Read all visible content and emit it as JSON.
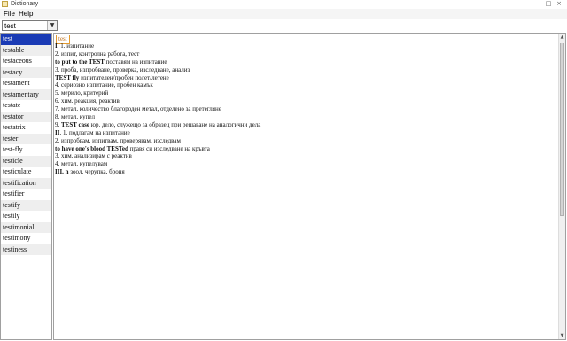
{
  "window": {
    "title": "Dictionary",
    "icon": "dictionary-app-icon"
  },
  "menu": {
    "file": "File",
    "help": "Help"
  },
  "search": {
    "value": "test",
    "dropdown_icon": "chevron-down-icon"
  },
  "word_list": {
    "selected": "test",
    "items": [
      "test",
      "testable",
      "testaceous",
      "testacy",
      "testament",
      "testamentary",
      "testate",
      "testator",
      "testatrix",
      "tester",
      "test-fly",
      "testicle",
      "testiculate",
      "testification",
      "testifier",
      "testify",
      "testily",
      "testimonial",
      "testimony",
      "testiness"
    ]
  },
  "definition": {
    "headword": "test",
    "lines": [
      [
        {
          "t": "I",
          "b": true
        },
        {
          "t": ". 1. изпитание"
        }
      ],
      [
        {
          "t": "2. изпит, контролна работа, тест"
        }
      ],
      [
        {
          "t": "to put to the TEST",
          "b": true
        },
        {
          "t": " поставям на изпитание"
        }
      ],
      [
        {
          "t": "3. проба, изпробване, проверка, изследване, анализ"
        }
      ],
      [
        {
          "t": "TEST fly",
          "b": true
        },
        {
          "t": " изпитателен/пробен полет/летене"
        }
      ],
      [
        {
          "t": "4. сериозно изпитание, пробен камък"
        }
      ],
      [
        {
          "t": "5. мерило, критерий"
        }
      ],
      [
        {
          "t": "6. хим. реакция, реактив"
        }
      ],
      [
        {
          "t": "7. метал. количество благороден метал, отделено за претегляне"
        }
      ],
      [
        {
          "t": "8. метал. купел"
        }
      ],
      [
        {
          "t": "9. "
        },
        {
          "t": "TEST case",
          "b": true
        },
        {
          "t": " юр. дело, служещо за образец при решаване на аналогични дела"
        }
      ],
      [
        {
          "t": "II",
          "b": true
        },
        {
          "t": ". 1. подлагам на изпитание"
        }
      ],
      [
        {
          "t": "2. изпробвам, изпитвам, проверявам, изследвам"
        }
      ],
      [
        {
          "t": "to have one's blood TESTed",
          "b": true
        },
        {
          "t": " правя си изследване на кръвта"
        }
      ],
      [
        {
          "t": "3. хим. анализирам с реактив"
        }
      ],
      [
        {
          "t": "4. метал. купелувам"
        }
      ],
      [
        {
          "t": "III. n",
          "b": true
        },
        {
          "t": " зоол. черупка, броня"
        }
      ]
    ]
  },
  "window_controls": {
    "minimize": "–",
    "maximize": "□",
    "close": "×"
  }
}
